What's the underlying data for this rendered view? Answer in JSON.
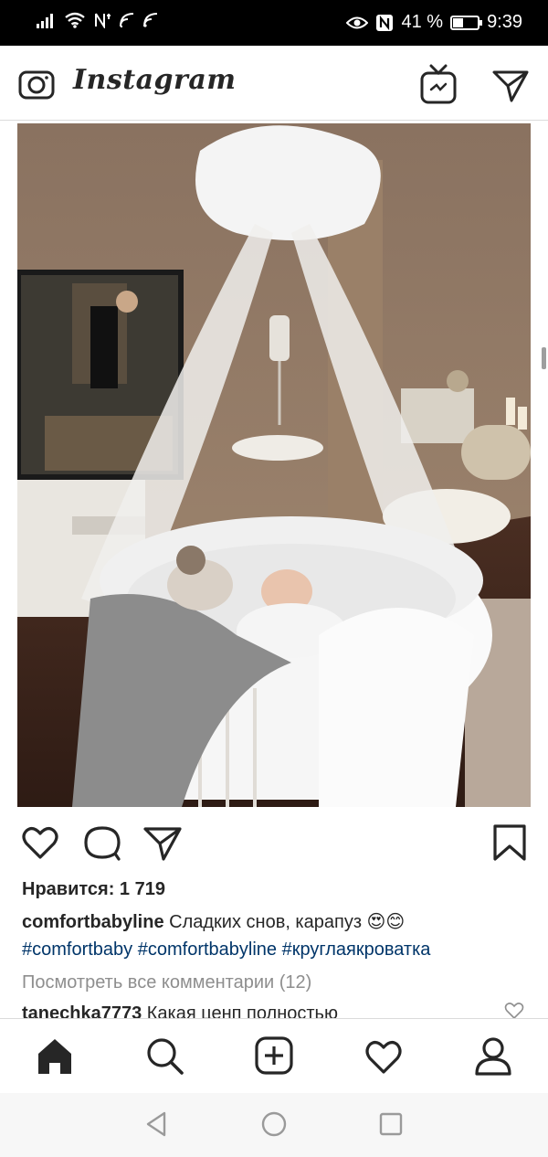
{
  "status_bar": {
    "icons": [
      "signal-icon",
      "wifi-icon",
      "nfc-icon",
      "data-icon"
    ],
    "battery_percent": "41 %",
    "battery_level": 0.41,
    "time": "9:39"
  },
  "header": {
    "brand": "Instagram",
    "icons": [
      "camera-icon",
      "igtv-icon",
      "direct-message-icon"
    ]
  },
  "post": {
    "likes_text": "Нравится: 1 719",
    "caption_user": "comfortbabyline",
    "caption_text": " Сладких снов, карапуз 😍😊",
    "caption_tags": "#comfortbaby #comfortbabyline #круглаякроватка",
    "view_comments": "Посмотреть все комментарии (12)",
    "comment_user": "tanechka7773",
    "comment_text": " Какая ценп полностью"
  },
  "colors": {
    "text": "#262626",
    "hashtag": "#003569",
    "muted": "#8e8e8e",
    "divider": "#dbdbdb"
  },
  "tab_bar": {
    "items": [
      "home-icon",
      "search-icon",
      "new-post-icon",
      "activity-icon",
      "profile-icon"
    ]
  },
  "system_nav": {
    "items": [
      "back-icon",
      "home-circle-icon",
      "recents-icon"
    ]
  }
}
